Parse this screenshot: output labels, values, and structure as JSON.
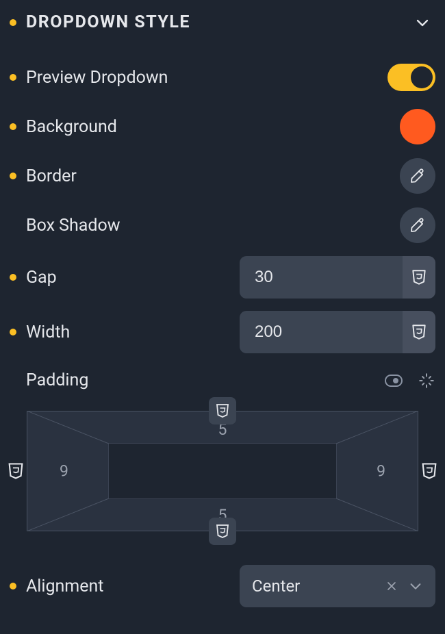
{
  "section": {
    "title": "DROPDOWN STYLE"
  },
  "rows": {
    "preview": {
      "label": "Preview Dropdown",
      "toggled": true
    },
    "background": {
      "label": "Background",
      "color": "#ff5a1f"
    },
    "border": {
      "label": "Border"
    },
    "boxShadow": {
      "label": "Box Shadow"
    },
    "gap": {
      "label": "Gap",
      "value": "30"
    },
    "width": {
      "label": "Width",
      "value": "200"
    },
    "padding": {
      "label": "Padding",
      "top": "5",
      "right": "9",
      "bottom": "5",
      "left": "9"
    },
    "alignment": {
      "label": "Alignment",
      "value": "Center"
    }
  },
  "icons": {
    "shieldLabel": "css-shield",
    "editLabel": "edit"
  }
}
